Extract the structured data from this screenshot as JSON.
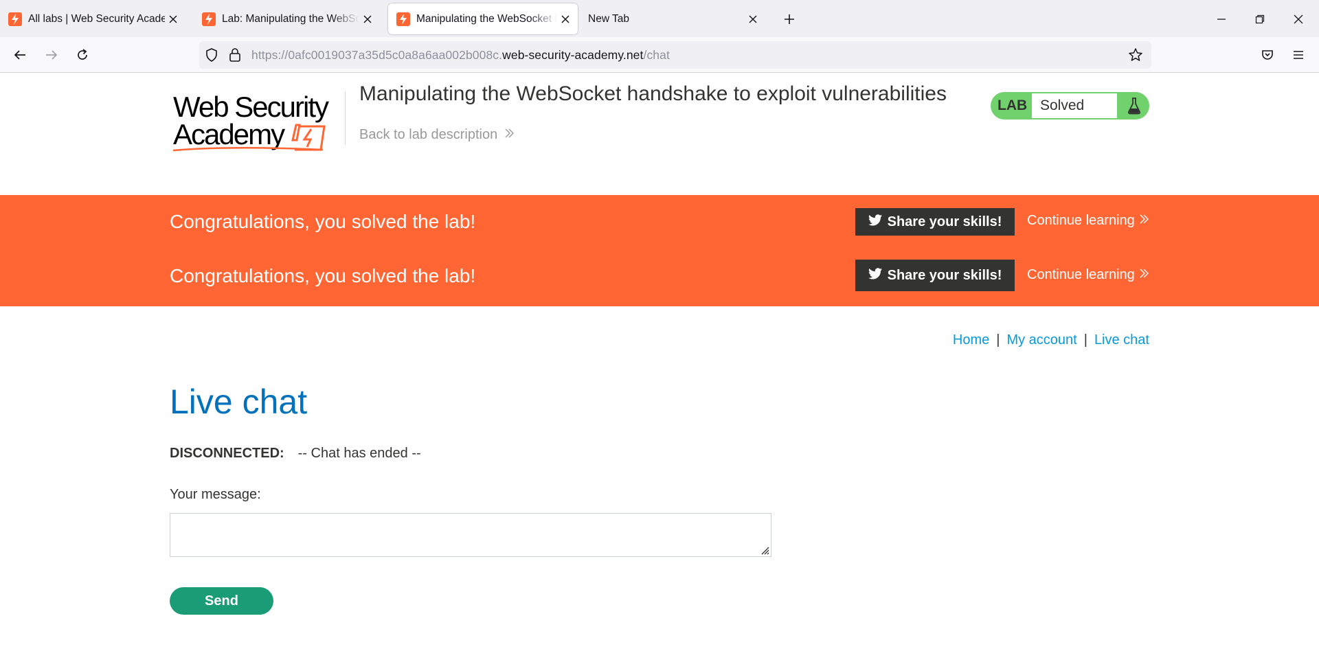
{
  "browser": {
    "tabs": [
      {
        "label": "All labs | Web Security Academy",
        "active": false
      },
      {
        "label": "Lab: Manipulating the WebSocket handshake",
        "active": false
      },
      {
        "label": "Manipulating the WebSocket handshake",
        "active": true
      },
      {
        "label": "New Tab",
        "active": false
      }
    ],
    "url": {
      "prefix": "https://0afc0019037a35d5c0a8a6aa002b008c.",
      "domain": "web-security-academy.net",
      "path": "/chat"
    }
  },
  "header": {
    "logo_line1": "Web Security",
    "logo_line2": "Academy",
    "lab_title": "Manipulating the WebSocket handshake to exploit vulnerabilities",
    "back_link": "Back to lab description",
    "status_label": "LAB",
    "status_value": "Solved",
    "status_color": "#70d16d"
  },
  "banner": {
    "color": "#ff6633",
    "rows": [
      {
        "message": "Congratulations, you solved the lab!",
        "share": "Share your skills!",
        "continue": "Continue learning"
      },
      {
        "message": "Congratulations, you solved the lab!",
        "share": "Share your skills!",
        "continue": "Continue learning"
      }
    ]
  },
  "nav": {
    "home": "Home",
    "separator": "|",
    "account": "My account",
    "chat": "Live chat"
  },
  "chat": {
    "heading": "Live chat",
    "messages": [
      {
        "from": "DISCONNECTED:",
        "text": "-- Chat has ended --"
      }
    ],
    "message_label": "Your message:",
    "message_value": "",
    "send_label": "Send"
  }
}
